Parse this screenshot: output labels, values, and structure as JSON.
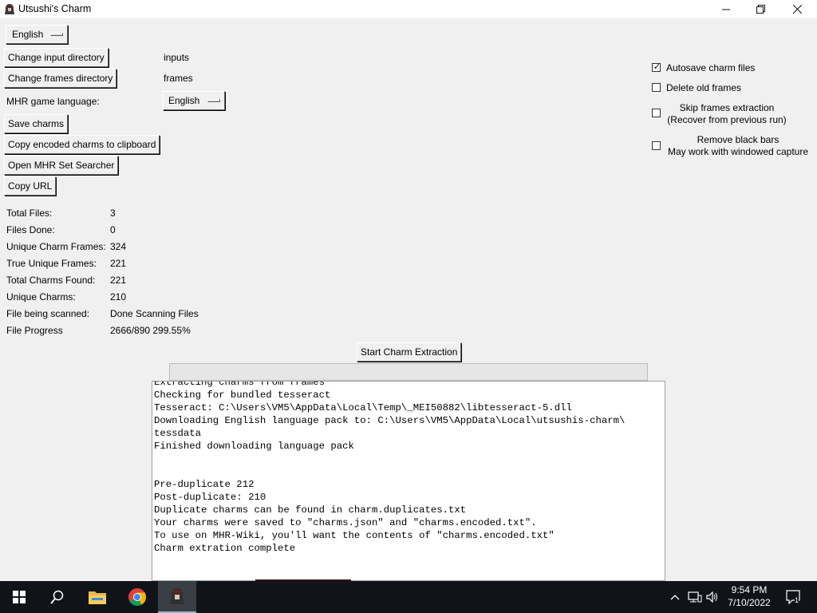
{
  "window": {
    "title": "Utsushi's Charm",
    "controls": {
      "minimize": "—",
      "maximize": "❐",
      "close": "✕"
    }
  },
  "toolbar": {
    "ui_language": "English",
    "change_input_label": "Change input directory",
    "input_dir": "inputs",
    "change_frames_label": "Change frames directory",
    "frames_dir": "frames",
    "game_language_label": "MHR game language:",
    "game_language": "English",
    "save_charms_label": "Save charms",
    "copy_encoded_label": "Copy encoded charms to clipboard",
    "open_searcher_label": "Open MHR Set Searcher",
    "copy_url_label": "Copy URL"
  },
  "options": {
    "autosave": {
      "label": "Autosave charm files",
      "checked": true
    },
    "delete_old": {
      "label": "Delete old frames",
      "checked": false
    },
    "skip_extraction": {
      "label_line1": "Skip frames extraction",
      "label_line2": "(Recover from previous run)",
      "checked": false
    },
    "remove_black_bars": {
      "label_line1": "Remove black bars",
      "label_line2": "May work with windowed capture",
      "checked": false
    }
  },
  "stats": [
    {
      "label": "Total Files:",
      "value": "3"
    },
    {
      "label": "Files Done:",
      "value": "0"
    },
    {
      "label": "Unique Charm Frames:",
      "value": "324"
    },
    {
      "label": "True Unique Frames:",
      "value": "221"
    },
    {
      "label": "Total Charms Found:",
      "value": "221"
    },
    {
      "label": "Unique Charms:",
      "value": "210"
    },
    {
      "label": "File being scanned:",
      "value": "Done Scanning Files"
    },
    {
      "label": "File Progress",
      "value": "2666/890 299.55%"
    }
  ],
  "actions": {
    "start_label": "Start Charm Extraction"
  },
  "progress": {
    "fraction": 0
  },
  "log": [
    "Extracting charms from frames",
    "Checking for bundled tesseract",
    "Tesseract: C:\\Users\\VM5\\AppData\\Local\\Temp\\_MEI50882\\libtesseract-5.dll",
    "Downloading English language pack to: C:\\Users\\VM5\\AppData\\Local\\utsushis-charm\\",
    "tessdata",
    "Finished downloading language pack",
    "",
    "",
    "Pre-duplicate 212",
    "Post-duplicate: 210",
    "Duplicate charms can be found in charm.duplicates.txt",
    "Your charms were saved to \"charms.json\" and \"charms.encoded.txt\".",
    "To use on MHR-Wiki, you'll want the contents of \"charms.encoded.txt\"",
    "Charm extration complete"
  ],
  "taskbar": {
    "time": "9:54 PM",
    "date": "7/10/2022",
    "notification_count": "1",
    "icons": [
      "windows-start-icon",
      "search-icon",
      "file-explorer-icon",
      "chrome-icon",
      "utsushis-charm-app-icon"
    ],
    "tray_icons": [
      "chevron-up-icon",
      "network-icon",
      "volume-icon"
    ]
  }
}
